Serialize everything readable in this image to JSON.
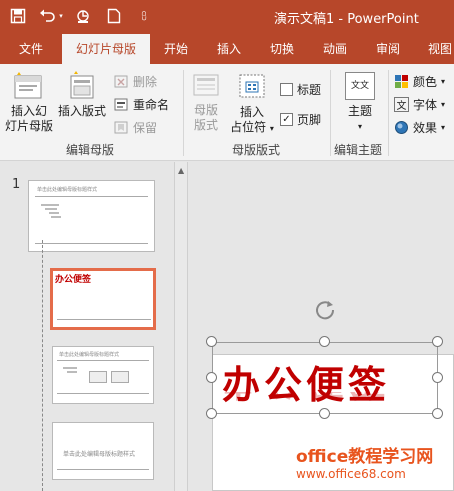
{
  "window": {
    "title": "演示文稿1 - PowerPoint"
  },
  "qat": {
    "icons": [
      "save-icon",
      "undo-icon",
      "redo-icon",
      "new-icon",
      "customize-icon"
    ]
  },
  "tabs": [
    {
      "label": "文件"
    },
    {
      "label": "幻灯片母版",
      "active": true
    },
    {
      "label": "开始"
    },
    {
      "label": "插入"
    },
    {
      "label": "切换"
    },
    {
      "label": "动画"
    },
    {
      "label": "审阅"
    },
    {
      "label": "视图"
    }
  ],
  "ribbon": {
    "edit_master": {
      "label": "编辑母版",
      "insert_master_label_1": "插入幻",
      "insert_master_label_2": "灯片母版",
      "insert_layout_label": "插入版式",
      "delete_label": "删除",
      "rename_label": "重命名",
      "preserve_label": "保留"
    },
    "master_layout": {
      "label": "母版版式",
      "master_layout_label_1": "母版",
      "master_layout_label_2": "版式",
      "insert_placeholder_label_1": "插入",
      "insert_placeholder_label_2": "占位符",
      "title_label": "标题",
      "footer_label": "页脚",
      "title_checked": false,
      "footer_checked": true
    },
    "edit_theme": {
      "label": "编辑主题",
      "theme_label": "主题",
      "theme_icon_text": "文文"
    },
    "background": {
      "colors_label": "颜色",
      "fonts_label": "字体",
      "effects_label": "效果"
    }
  },
  "thumbnails": {
    "slide_number": "1",
    "thumb1_title": "单击此处编辑母版标题样式",
    "thumb2_title": "办公便签",
    "thumb3_title": "单击此处编辑母版标题样式",
    "thumb4_title": "单击此处编辑母版标题样式"
  },
  "slide": {
    "title": "办公便签"
  },
  "watermark": {
    "line1": "office教程学习网",
    "line2": "www.office68.com"
  },
  "colors": {
    "accent": "#b7472a",
    "title_red": "#c00000",
    "selection": "#e46c4a"
  }
}
